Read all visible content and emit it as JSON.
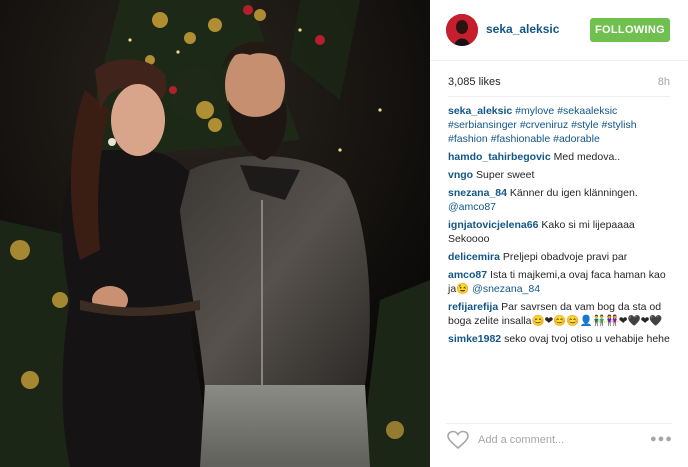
{
  "post": {
    "username": "seka_aleksic",
    "follow_label": "FOLLOWING",
    "likes": "3,085 likes",
    "time": "8h",
    "caption": {
      "author": "seka_aleksic",
      "tags": [
        "#mylove",
        "#sekaaleksic",
        "#serbiansinger",
        "#crveniruz",
        "#style",
        "#stylish",
        "#fashion",
        "#fashionable",
        "#adorable"
      ]
    },
    "comments": [
      {
        "author": "hamdo_tahirbegovic",
        "text": "Med medova.."
      },
      {
        "author": "vngo",
        "text": "Super sweet"
      },
      {
        "author": "snezana_84",
        "text": "Känner du igen klänningen.",
        "mention": "@amco87"
      },
      {
        "author": "ignjatovicjelena66",
        "text": "Kako si mi lijepaaaa Sekoooo"
      },
      {
        "author": "delicemira",
        "text": "Preljepi obadvoje pravi par"
      },
      {
        "author": "amco87",
        "text": "Ista ti majkemi,a ovaj faca haman kao ja😉",
        "mention": "@snezana_84"
      },
      {
        "author": "refijarefija",
        "text": "Par savrsen da vam bog da sta od boga zelite insalla😊❤😊😊👤👬👭❤🖤❤🖤"
      },
      {
        "author": "simke1982",
        "text": "seko ovaj tvoj otiso u vehabije hehe"
      }
    ],
    "comment_placeholder": "Add a comment...",
    "more_label": "●●●"
  },
  "colors": {
    "link": "#125688",
    "follow_bg": "#70c050",
    "muted": "#a5a7aa",
    "avatar_bg": "#c61e2e"
  },
  "icons": {
    "like": "heart-outline-icon",
    "more": "ellipsis-icon"
  }
}
